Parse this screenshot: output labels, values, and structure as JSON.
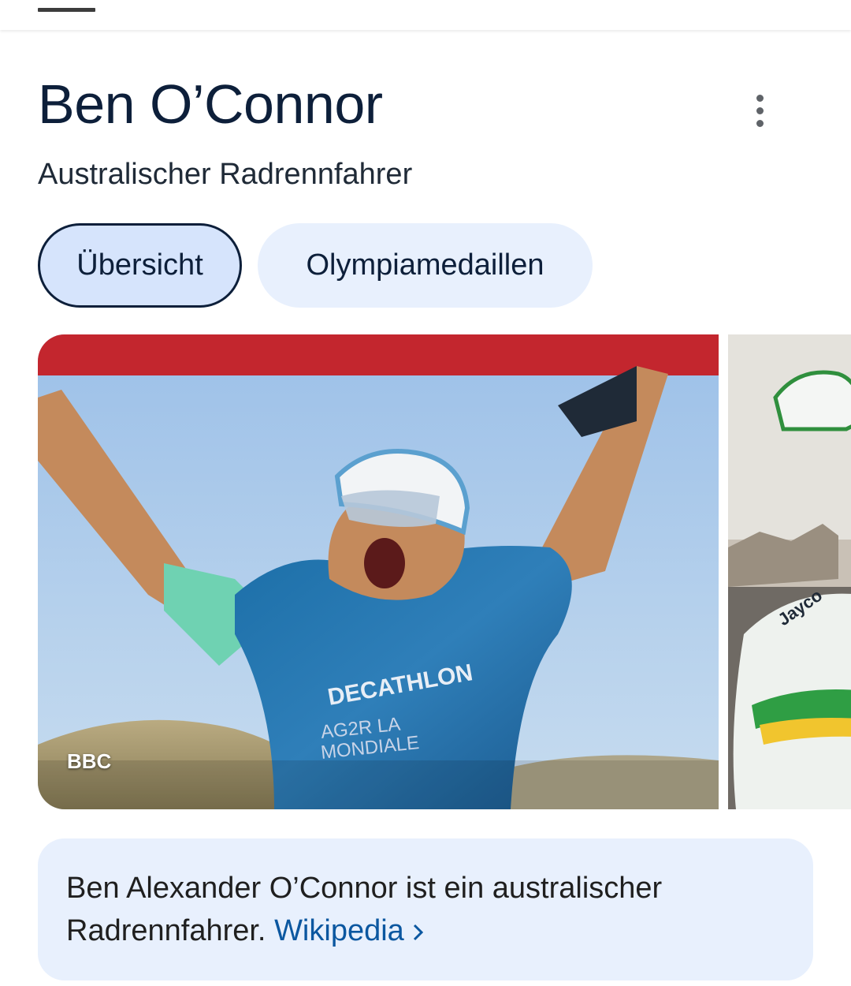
{
  "header": {
    "title": "Ben O’Connor",
    "subtitle": "Australischer Radrennfahrer"
  },
  "tabs": [
    {
      "label": "Übersicht",
      "active": true
    },
    {
      "label": "Olympiamedaillen",
      "active": false
    }
  ],
  "images": [
    {
      "source": "BBC",
      "jersey_text_1": "DECATHLON",
      "jersey_text_2": "AG2R LA",
      "jersey_text_3": "MONDIALE"
    },
    {
      "source": "",
      "jersey_text_1": "Jayco"
    }
  ],
  "description": {
    "text": "Ben Alexander O’Connor ist ein australischer Radrennfahrer.",
    "link_label": "Wikipedia"
  },
  "icons": {
    "more": "more-vert-icon",
    "chevron": "chevron-right-icon"
  },
  "colors": {
    "title": "#0d1f3a",
    "chip_active_bg": "#d6e4fc",
    "chip_bg": "#e8f0fd",
    "card_bg": "#e8f0fd",
    "link": "#0b57a0"
  }
}
